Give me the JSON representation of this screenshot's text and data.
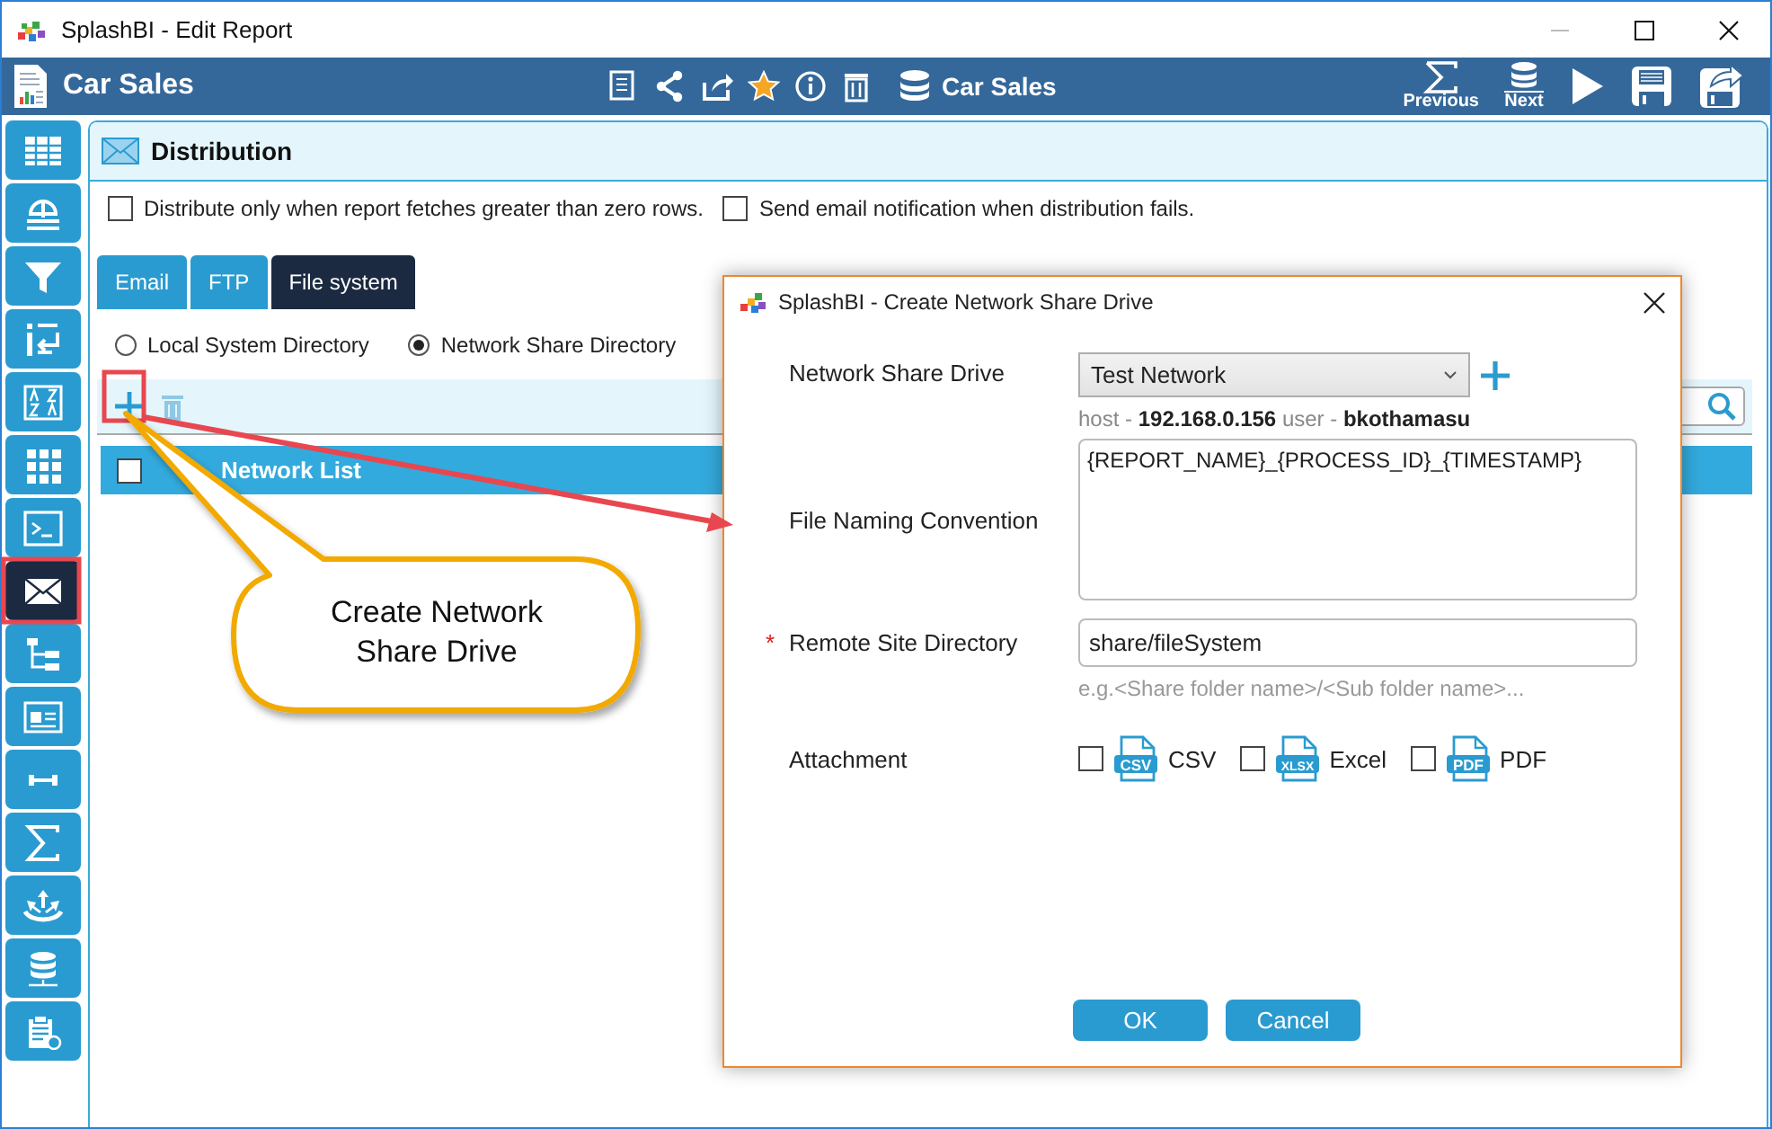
{
  "window": {
    "title": "SplashBI - Edit Report"
  },
  "header": {
    "report_title": "Car Sales",
    "datasource": "Car Sales",
    "actions": [
      {
        "kind": "previous",
        "label": "Previous"
      },
      {
        "kind": "next",
        "label": "Next"
      }
    ]
  },
  "sidebar": {
    "items": [
      {
        "kind": "table",
        "selected": false
      },
      {
        "kind": "scale",
        "selected": false
      },
      {
        "kind": "filter",
        "selected": false
      },
      {
        "kind": "sort",
        "selected": false
      },
      {
        "kind": "az",
        "selected": false
      },
      {
        "kind": "grid",
        "selected": false
      },
      {
        "kind": "terminal",
        "selected": false
      },
      {
        "kind": "mail",
        "selected": true
      },
      {
        "kind": "tree",
        "selected": false
      },
      {
        "kind": "form",
        "selected": false
      },
      {
        "kind": "range",
        "selected": false
      },
      {
        "kind": "sigma",
        "selected": false
      },
      {
        "kind": "fan",
        "selected": false
      },
      {
        "kind": "database",
        "selected": false
      },
      {
        "kind": "clipboard",
        "selected": false
      }
    ]
  },
  "panel": {
    "title": "Distribution",
    "options": [
      {
        "label": "Distribute only when report fetches greater than zero rows.",
        "checked": false
      },
      {
        "label": "Send email notification when distribution fails.",
        "checked": false
      }
    ],
    "tabs": [
      {
        "label": "Email",
        "selected": false
      },
      {
        "label": "FTP",
        "selected": false
      },
      {
        "label": "File system",
        "selected": true
      }
    ],
    "directory_options": [
      {
        "label": "Local System Directory",
        "selected": false
      },
      {
        "label": "Network Share Directory",
        "selected": true
      }
    ],
    "list": {
      "header": "Network List",
      "checked": false
    }
  },
  "dialog": {
    "title": "SplashBI - Create Network Share Drive",
    "network_share_drive": {
      "label": "Network Share Drive",
      "value": "Test Network",
      "connection": "host - **192.168.0.156**  user - **bkothamasu**"
    },
    "file_naming": {
      "label": "File Naming Convention",
      "value": "{REPORT_NAME}_{PROCESS_ID}_{TIMESTAMP}"
    },
    "remote_directory": {
      "label": "Remote Site Directory",
      "required_mark": "*",
      "value": "share/fileSystem",
      "hint": "e.g.<Share folder name>/<Sub folder name>..."
    },
    "attachment": {
      "label": "Attachment",
      "options": [
        {
          "label": "CSV",
          "badge": "CSV",
          "checked": false
        },
        {
          "label": "Excel",
          "badge": "XLSX",
          "checked": false
        },
        {
          "label": "PDF",
          "badge": "PDF",
          "checked": false
        }
      ]
    },
    "buttons": [
      "OK",
      "Cancel"
    ]
  },
  "annotation": {
    "text": "Create Network\nShare Drive"
  }
}
